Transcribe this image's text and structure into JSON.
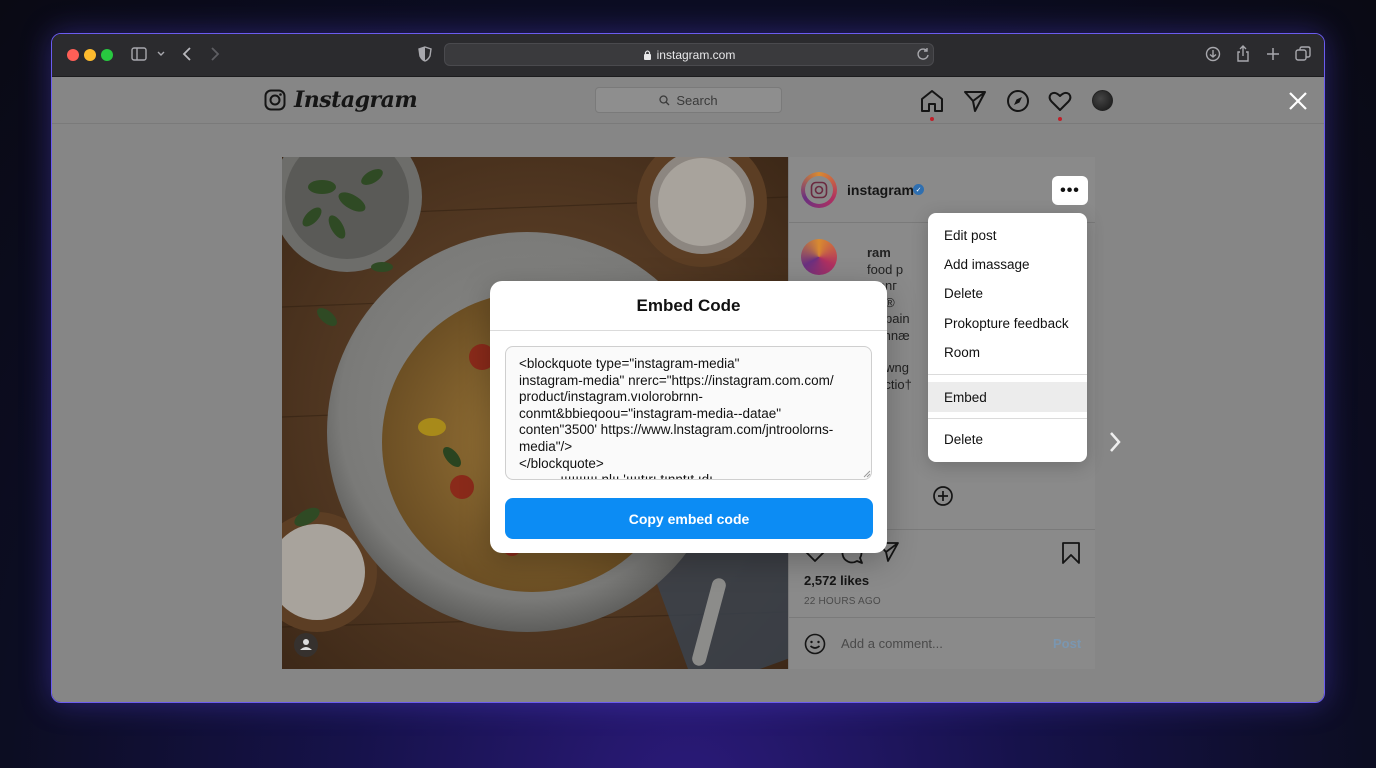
{
  "browser": {
    "url": "instagram.com"
  },
  "instagram": {
    "logo_text": "Instagram",
    "search_placeholder": "Search"
  },
  "post": {
    "username": "instagram",
    "caption_fragments": [
      "ram",
      "food p",
      "menг",
      "hat®",
      "ampain",
      "wannæ",
      "tahwng",
      "iductio†"
    ],
    "likes": "2,572 likes",
    "time": "22 HOURS AGO",
    "comment_placeholder": "Add a comment...",
    "post_button": "Post"
  },
  "embed_modal": {
    "title": "Embed Code",
    "code": "<blockquote type=\"instagram-media\"\ninstagram-media\" nrerc=\"https://instagram.com.com/\nproduct/instagram.vıolorobrnn-\nconmt&bbieqoou=\"instagram-media--datae\"\nconten\"3500' https://www.lnstagram.com/jntroolorns-\nmedia\"/>\n</blockquote>\n           ıııııııııı nlıı 'ııııtırı tınntıt ıdı",
    "copy_button": "Copy embed code"
  },
  "options_menu": {
    "items": [
      "Edit post",
      "Add imassage",
      "Delete",
      "Prokopture feedback",
      "Room"
    ],
    "embed": "Embed",
    "delete": "Delete"
  },
  "colors": {
    "accent": "#0c8cf4",
    "verified": "#3897f0"
  }
}
